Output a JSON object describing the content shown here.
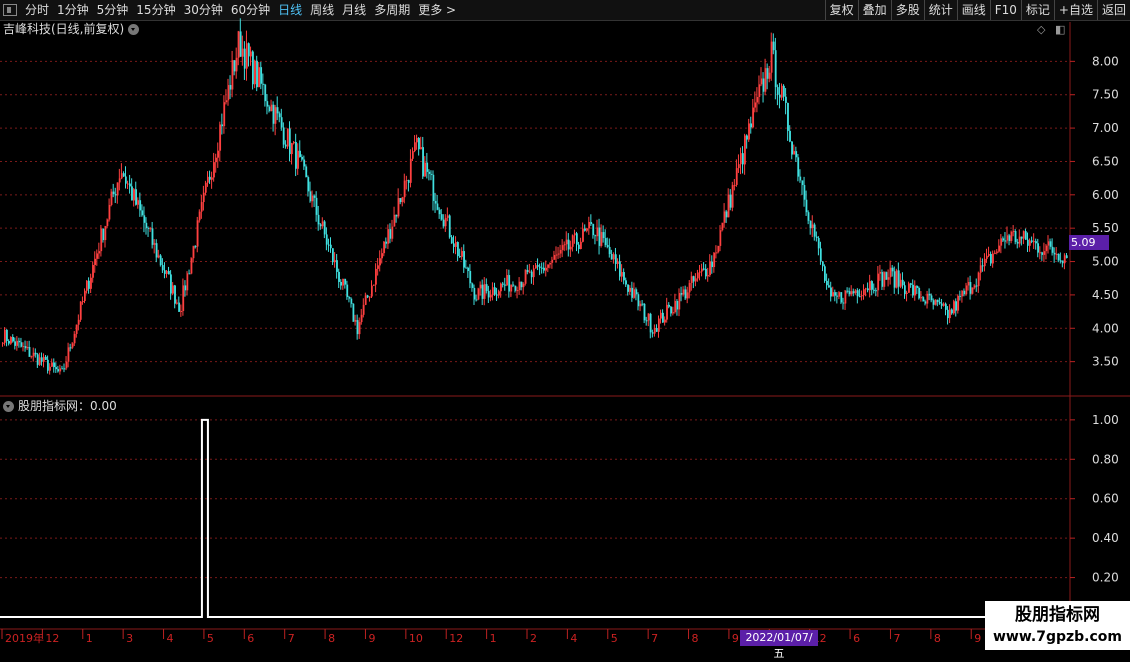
{
  "toolbar": {
    "periods": [
      "分时",
      "1分钟",
      "5分钟",
      "15分钟",
      "30分钟",
      "60分钟",
      "日线",
      "周线",
      "月线",
      "多周期",
      "更多 >"
    ],
    "active_period": "日线",
    "right_buttons": [
      "复权",
      "叠加",
      "多股",
      "统计",
      "画线",
      "F10",
      "标记",
      "+自选",
      "返回"
    ]
  },
  "main_chart": {
    "title": "吉峰科技(日线,前复权)",
    "y_ticks": [
      "8.00",
      "7.50",
      "7.00",
      "6.50",
      "6.00",
      "5.50",
      "5.00",
      "4.50",
      "4.00",
      "3.50"
    ],
    "current_price": "5.09"
  },
  "indicator": {
    "title": "股朋指标网：0.00",
    "y_ticks": [
      "1.00",
      "0.80",
      "0.60",
      "0.40",
      "0.20"
    ]
  },
  "time_axis": {
    "labels": [
      "2019年",
      "12",
      "1",
      "3",
      "4",
      "5",
      "6",
      "7",
      "8",
      "9",
      "10",
      "12",
      "1",
      "2",
      "4",
      "5",
      "7",
      "8",
      "9",
      "10",
      "12",
      "6",
      "7",
      "8",
      "9",
      "10"
    ],
    "cursor_date": "2022/01/07/五"
  },
  "watermark": {
    "line1": "股朋指标网",
    "line2": "www.7gpzb.com"
  },
  "colors": {
    "up": "#ff4040",
    "down": "#40e0e0",
    "grid": "#7a1a1a",
    "accent": "#5b1fa8",
    "active": "#4fc3f7"
  },
  "chart_data": {
    "type": "candlestick",
    "title": "吉峰科技(日线,前复权)",
    "ylim": [
      3.0,
      8.35
    ],
    "key_prices": [
      {
        "period": "2019年",
        "price": 3.9
      },
      {
        "period": "4",
        "price": 3.3
      },
      {
        "period": "5",
        "price": 6.4
      },
      {
        "period": "6",
        "price": 4.3
      },
      {
        "period": "9",
        "price": 8.3
      },
      {
        "period": "10",
        "price": 6.5
      },
      {
        "period": "1",
        "price": 4.0
      },
      {
        "period": "2",
        "price": 6.7
      },
      {
        "period": "4",
        "price": 4.5
      },
      {
        "period": "7",
        "price": 4.8
      },
      {
        "period": "9",
        "price": 5.5
      },
      {
        "period": "10",
        "price": 4.0
      },
      {
        "period": "12",
        "price": 5.0
      },
      {
        "period": "2022/01/07",
        "price": 8.1
      },
      {
        "period": "6",
        "price": 4.4
      },
      {
        "period": "8",
        "price": 4.8
      },
      {
        "period": "9",
        "price": 4.2
      },
      {
        "period": "10",
        "price": 5.4
      },
      {
        "period": "10",
        "price": 5.09
      }
    ],
    "indicator_value": 0.0,
    "indicator_spike": {
      "position": "5",
      "value": 1.0
    }
  }
}
